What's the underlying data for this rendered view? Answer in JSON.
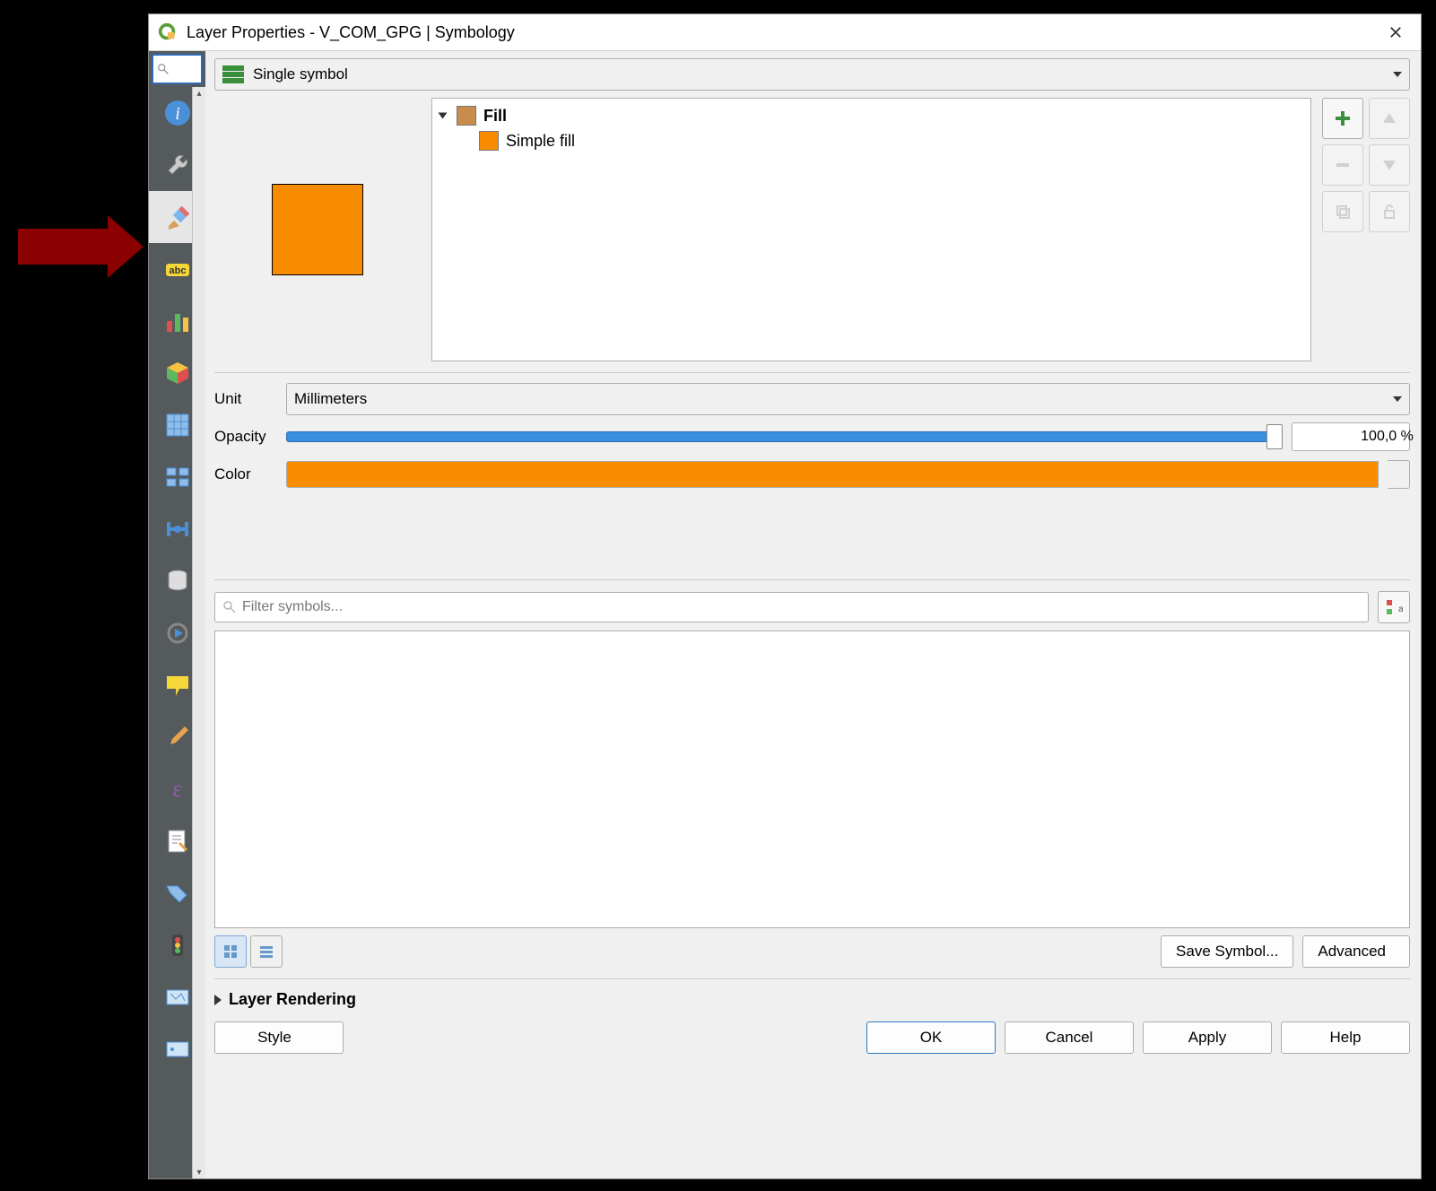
{
  "window": {
    "title": "Layer Properties - V_COM_GPG | Symbology"
  },
  "renderer": {
    "selected": "Single symbol"
  },
  "symbol_tree": {
    "root": "Fill",
    "child": "Simple fill"
  },
  "unit": {
    "label": "Unit",
    "value": "Millimeters"
  },
  "opacity": {
    "label": "Opacity",
    "value": "100,0 %"
  },
  "color": {
    "label": "Color",
    "value": "#f78c00"
  },
  "filter": {
    "placeholder": "Filter symbols..."
  },
  "buttons": {
    "save_symbol": "Save Symbol...",
    "advanced": "Advanced",
    "style": "Style",
    "ok": "OK",
    "cancel": "Cancel",
    "apply": "Apply",
    "help": "Help"
  },
  "sections": {
    "layer_rendering": "Layer Rendering"
  },
  "sidebar": {
    "tabs": [
      "information",
      "source",
      "symbology",
      "labels",
      "diagrams",
      "3d-view",
      "fields",
      "attributes-form",
      "joins",
      "auxiliary-storage",
      "actions",
      "display",
      "rendering",
      "temporal",
      "variables",
      "metadata",
      "dependencies",
      "legend",
      "qgis-server"
    ],
    "selected_index": 2
  }
}
